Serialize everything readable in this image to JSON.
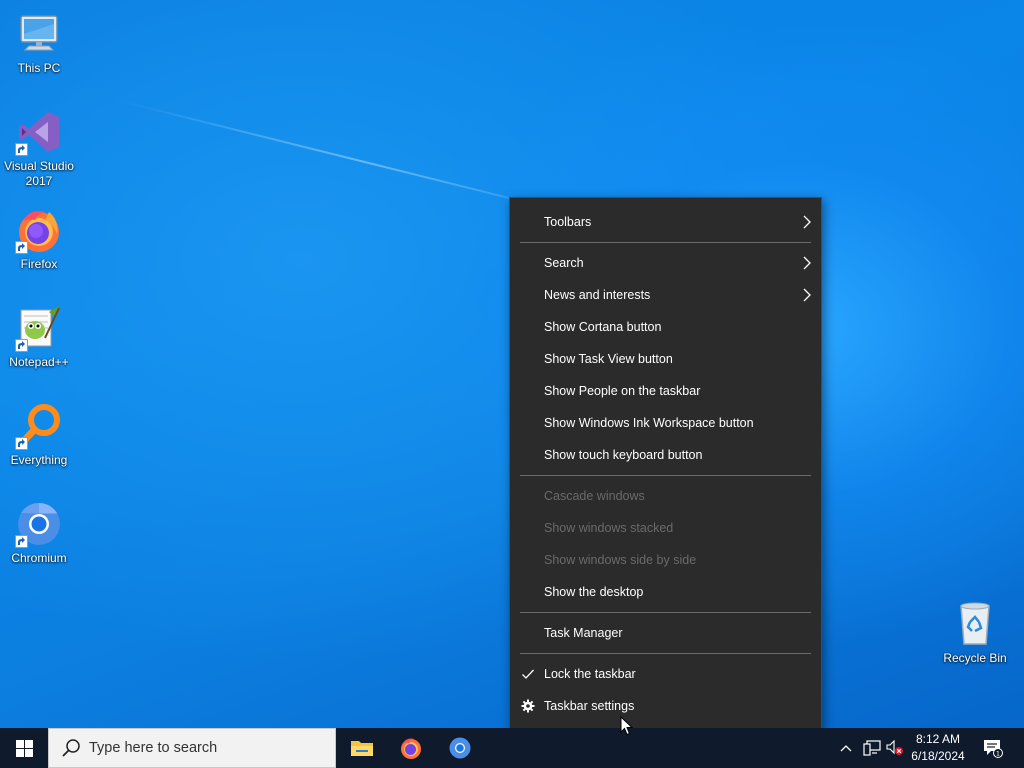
{
  "desktop": {
    "icons": [
      {
        "label": "This PC",
        "icon": "monitor-icon"
      },
      {
        "label": "Visual Studio 2017",
        "icon": "visual-studio-icon"
      },
      {
        "label": "Firefox",
        "icon": "firefox-icon"
      },
      {
        "label": "Notepad++",
        "icon": "notepadpp-icon"
      },
      {
        "label": "Everything",
        "icon": "everything-search-icon"
      },
      {
        "label": "Chromium",
        "icon": "chromium-icon"
      },
      {
        "label": "Recycle Bin",
        "icon": "recycle-bin-icon"
      }
    ]
  },
  "context_menu": {
    "items": [
      {
        "label": "Toolbars",
        "submenu": true,
        "disabled": false
      },
      {
        "label": "Search",
        "submenu": true,
        "disabled": false
      },
      {
        "label": "News and interests",
        "submenu": true,
        "disabled": false
      },
      {
        "label": "Show Cortana button",
        "disabled": false
      },
      {
        "label": "Show Task View button",
        "disabled": false
      },
      {
        "label": "Show People on the taskbar",
        "disabled": false
      },
      {
        "label": "Show Windows Ink Workspace button",
        "disabled": false
      },
      {
        "label": "Show touch keyboard button",
        "disabled": false
      },
      {
        "label": "Cascade windows",
        "disabled": true
      },
      {
        "label": "Show windows stacked",
        "disabled": true
      },
      {
        "label": "Show windows side by side",
        "disabled": true
      },
      {
        "label": "Show the desktop",
        "disabled": false
      },
      {
        "label": "Task Manager",
        "disabled": false
      },
      {
        "label": "Lock the taskbar",
        "checked": true,
        "disabled": false
      },
      {
        "label": "Taskbar settings",
        "icon": "gear-icon",
        "disabled": false
      }
    ]
  },
  "taskbar": {
    "search_placeholder": "Type here to search",
    "pinned": [
      "file-explorer-icon",
      "firefox-icon",
      "chromium-icon"
    ],
    "tray": {
      "time": "8:12 AM",
      "date": "6/18/2024",
      "notification_count": "1"
    }
  },
  "colors": {
    "menu_bg": "#2b2b2b",
    "menu_disabled_text": "#6a6a6a",
    "taskbar_bg": "#0f1b2d",
    "desktop_blue": "#0a7ee0"
  }
}
